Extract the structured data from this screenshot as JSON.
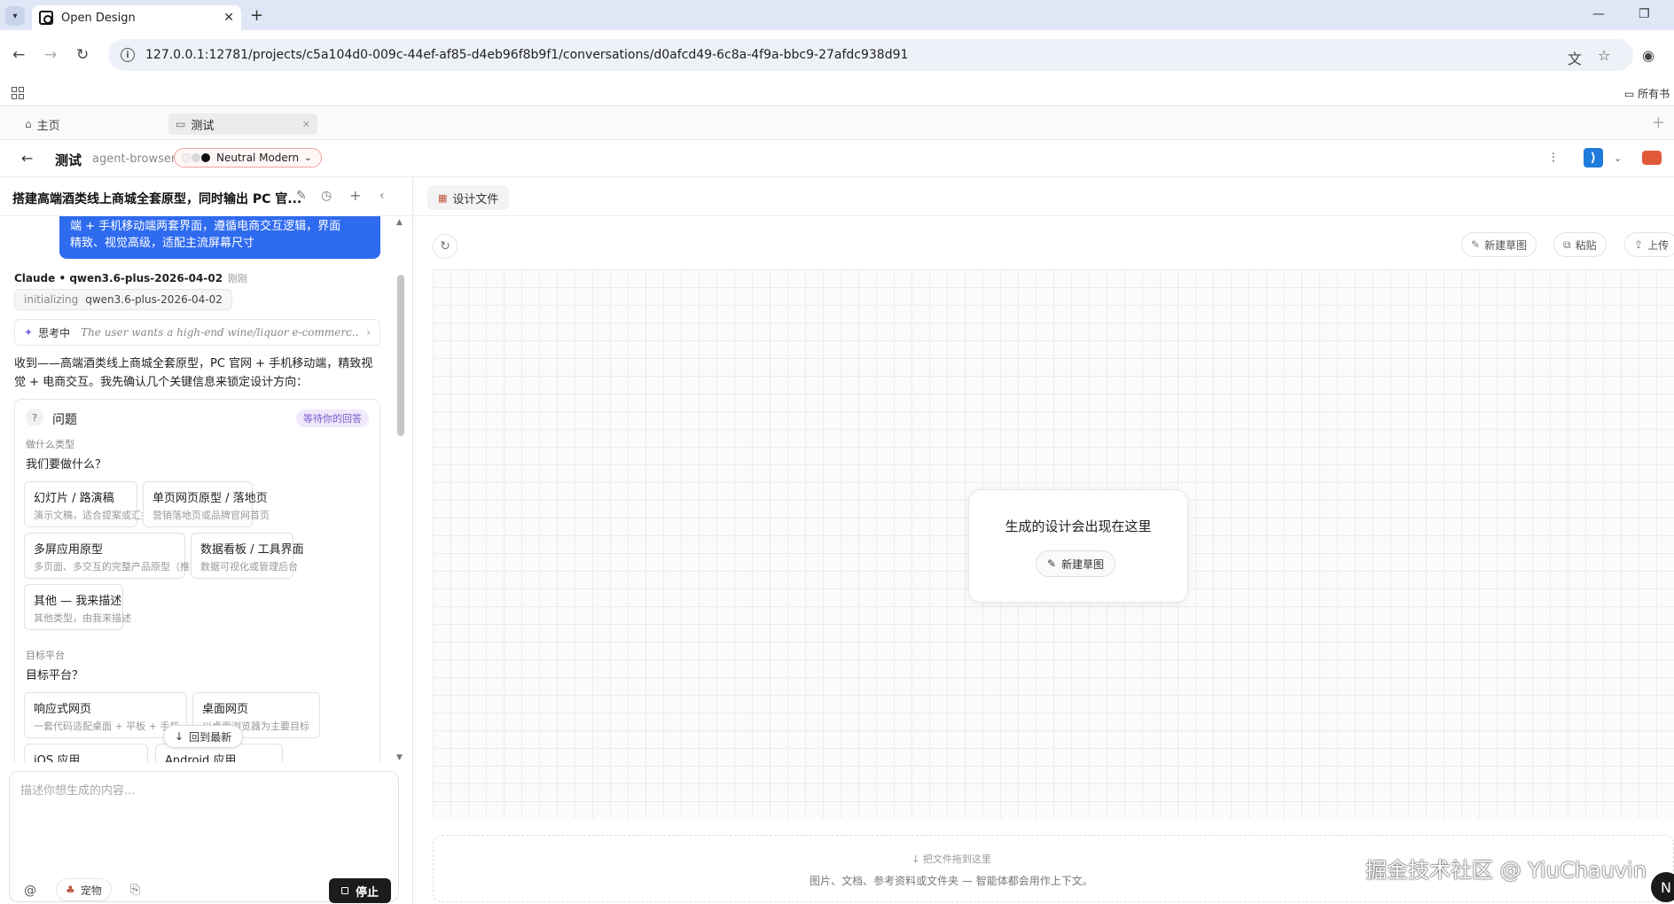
{
  "browser": {
    "tab_title": "Open Design",
    "url": "127.0.0.1:12781/projects/c5a104d0-009c-44ef-af85-d4eb96f8b9f1/conversations/d0afcd49-6c8a-4f9a-bbc9-27afdc938d91",
    "bookmarks_all": "所有书"
  },
  "app_tabs": [
    {
      "label": "主页"
    },
    {
      "label": "测试"
    }
  ],
  "project": {
    "title": "测试",
    "agent": "agent-browser",
    "theme": "Neutral Modern"
  },
  "conversation": {
    "title": "搭建高端酒类线上商城全套原型，同时输出 PC 官...",
    "user_message_lines": [
      "端 + 手机移动端两套界面，遵循电商交互逻辑，界面",
      "精致、视觉高级，适配主流屏幕尺寸"
    ],
    "assistant_meta": "Claude • qwen3.6-plus-2026-04-02",
    "assistant_time": "刚刚",
    "init_status": "initializing",
    "init_model": "qwen3.6-plus-2026-04-02",
    "thinking_label": "思考中",
    "thinking_text": "The user wants a high-end wine/liquor e-commerc...",
    "reply": "收到——高端酒类线上商城全套原型，PC 官网 + 手机移动端，精致视觉 + 电商交互。我先确认几个关键信息来锁定设计方向："
  },
  "question": {
    "title": "问题",
    "status": "等待你的回答",
    "groups": [
      {
        "category": "做什么类型",
        "ask": "我们要做什么？",
        "options": [
          {
            "title": "幻灯片 / 路演稿",
            "desc": "演示文稿，适合提案或汇报"
          },
          {
            "title": "单页网页原型 / 落地页",
            "desc": "营销落地页或品牌官网首页"
          },
          {
            "title": "多屏应用原型",
            "desc": "多页面、多交互的完整产品原型（推荐）"
          },
          {
            "title": "数据看板 / 工具界面",
            "desc": "数据可视化或管理后台"
          },
          {
            "title": "其他 — 我来描述",
            "desc": "其他类型，由我来描述"
          }
        ]
      },
      {
        "category": "目标平台",
        "ask": "目标平台？",
        "options": [
          {
            "title": "响应式网页",
            "desc": "一套代码适配桌面 + 平板 + 手机"
          },
          {
            "title": "桌面网页",
            "desc": "以桌面浏览器为主要目标"
          },
          {
            "title": "iOS 应用",
            "desc": ""
          },
          {
            "title": "Android 应用",
            "desc": ""
          }
        ]
      }
    ]
  },
  "jump_latest": "回到最新",
  "composer": {
    "placeholder": "描述你想生成的内容...",
    "pet_label": "宠物",
    "stop_label": "停止"
  },
  "right": {
    "tab": "设计文件",
    "new_sketch": "新建草图",
    "paste": "粘贴",
    "upload": "上传",
    "placeholder_text": "生成的设计会出现在这里",
    "placeholder_button": "新建草图",
    "drop_title": "把文件拖到这里",
    "drop_desc": "图片、文档、参考资料或文件夹 — 智能体都会用作上下文。"
  },
  "watermark": "掘金技术社区 @ YiuChauvin",
  "avatar_letter": "N",
  "colors": {
    "accent_blue": "#2f6bef",
    "status_purple": "#7c59c9",
    "brand_orange": "#c0553a"
  }
}
